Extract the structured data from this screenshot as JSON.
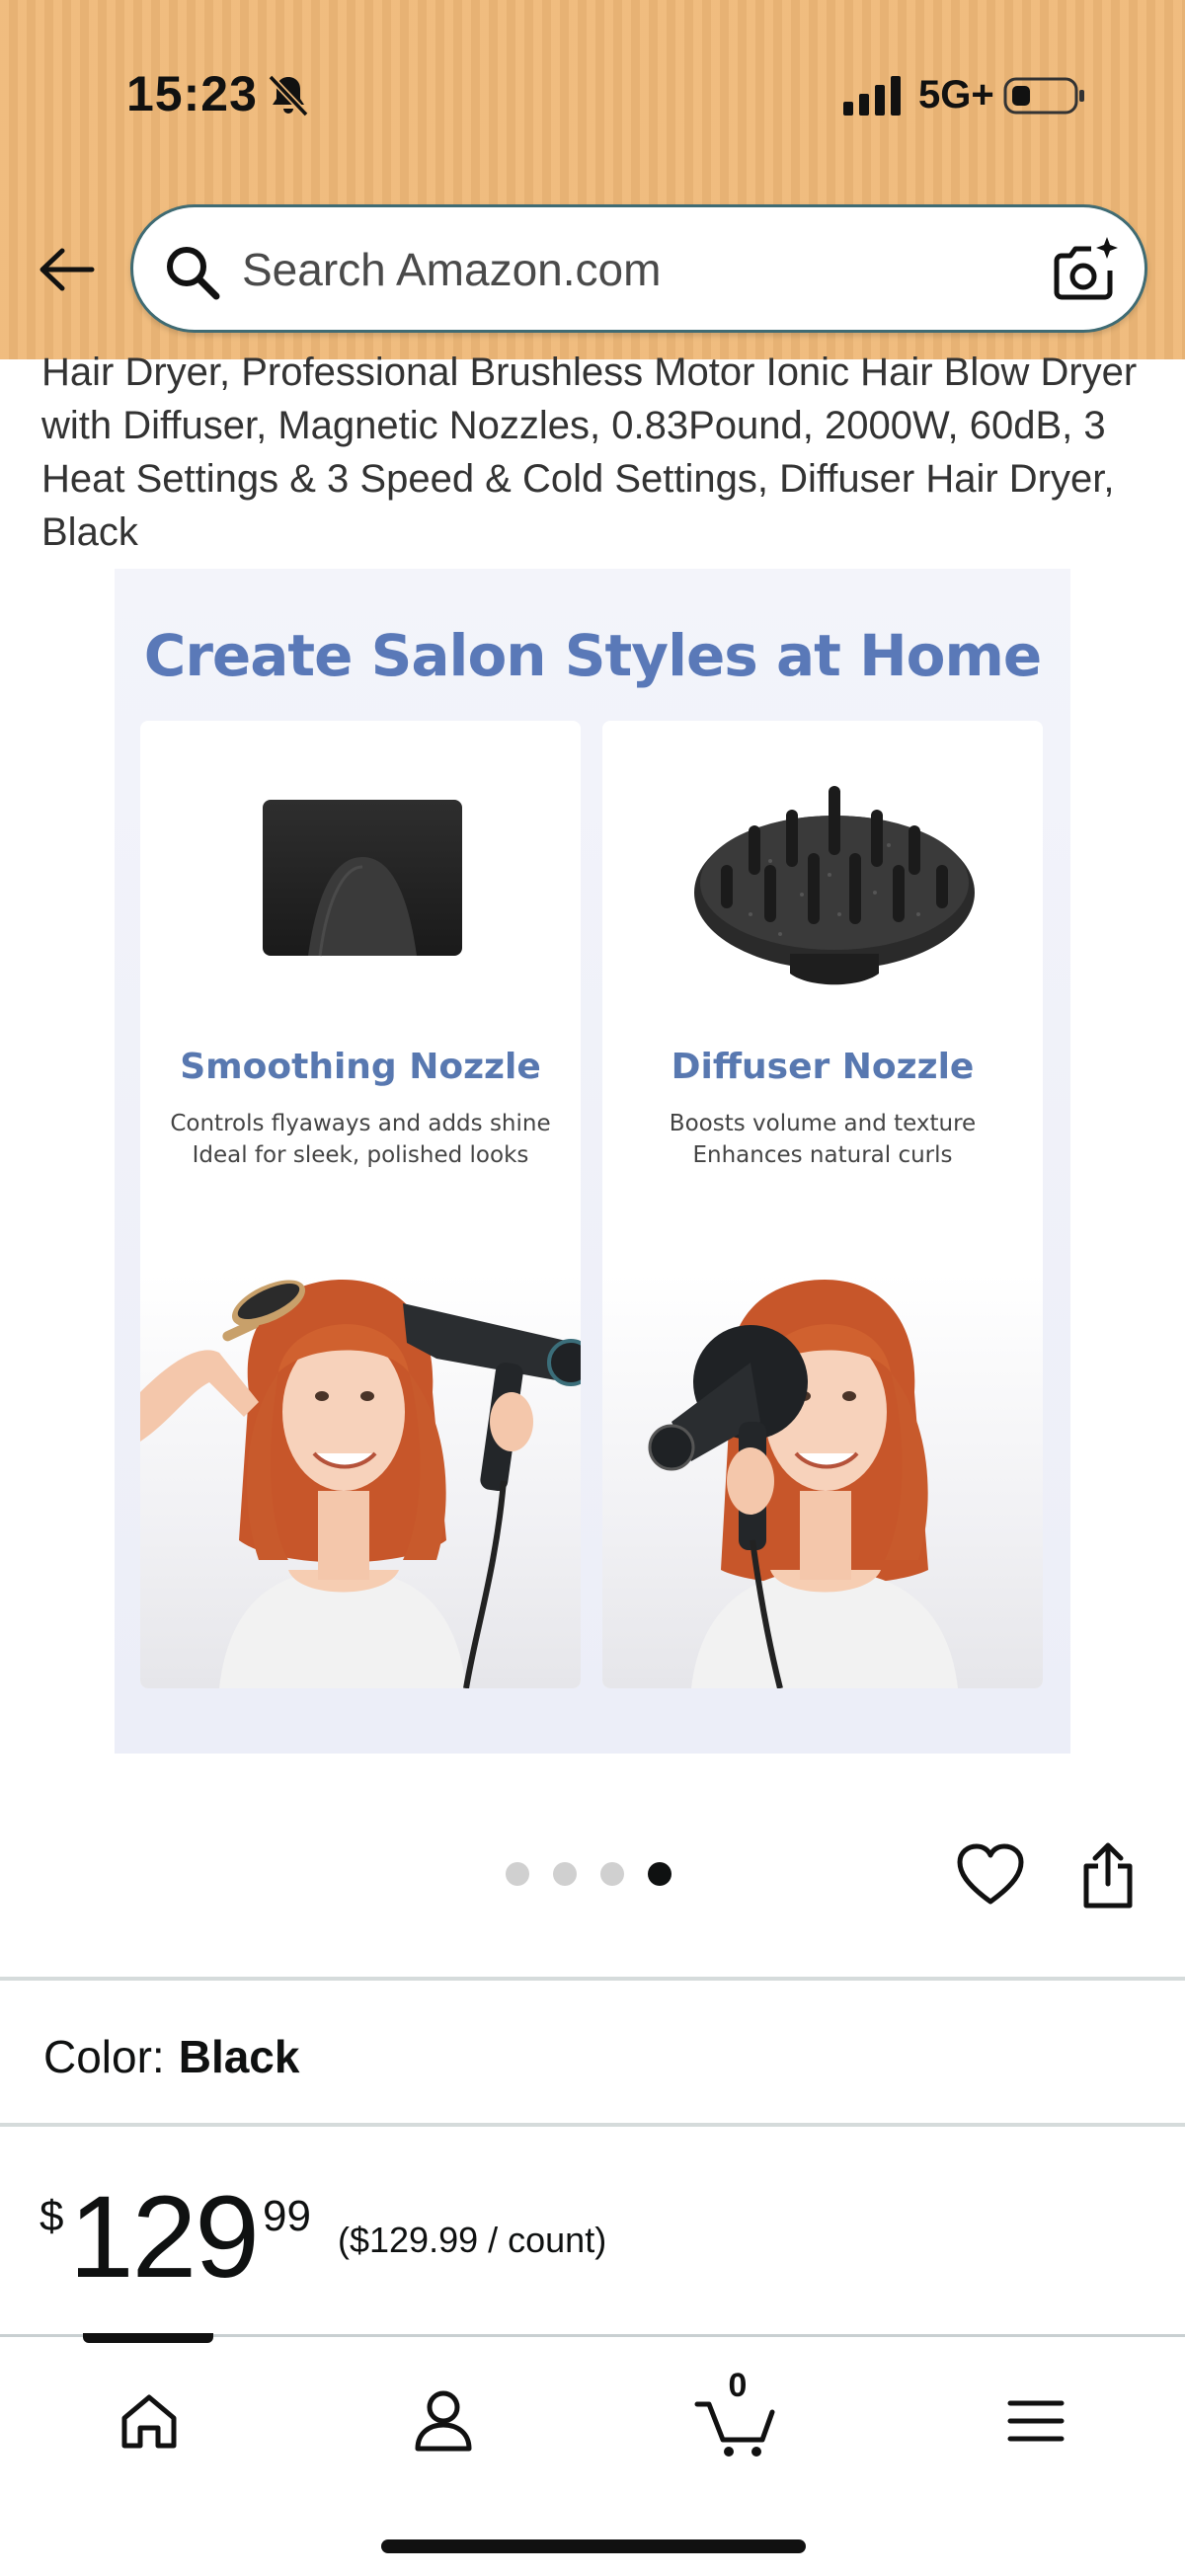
{
  "status_bar": {
    "time": "15:23",
    "network": "5G+",
    "icons": [
      "bell-slash-icon",
      "signal-icon",
      "battery-icon"
    ]
  },
  "header": {
    "back_icon": "arrow-left-icon",
    "search_placeholder": "Search Amazon.com",
    "search_icon": "search-icon",
    "camera_icon": "camera-search-icon",
    "background_color": "#efb978"
  },
  "product": {
    "title": "Hair Dryer, Professional Brushless Motor Ionic Hair Blow Dryer with Diffuser, Magnetic Nozzles, 0.83Pound, 2000W, 60dB, 3 Heat Settings & 3 Speed & Cold Settings, Diffuser Hair Dryer, Black",
    "image": {
      "heading": "Create Salon Styles at Home",
      "cards": [
        {
          "title": "Smoothing Nozzle",
          "line1": "Controls flyaways and adds shine",
          "line2": "Ideal for sleek, polished looks"
        },
        {
          "title": "Diffuser Nozzle",
          "line1": "Boosts volume and texture",
          "line2": "Enhances natural curls"
        }
      ]
    },
    "carousel": {
      "total": 4,
      "active_index": 3
    },
    "actions": {
      "favorite_icon": "heart-icon",
      "share_icon": "share-icon"
    },
    "color": {
      "label": "Color:",
      "value": "Black"
    },
    "price": {
      "symbol": "$",
      "whole": "129",
      "fraction": "99",
      "unit": "($129.99 / count)"
    }
  },
  "bottom_nav": {
    "items": [
      "home-icon",
      "account-icon",
      "cart-icon",
      "menu-icon"
    ],
    "cart_count": "0"
  },
  "colors": {
    "accent_heading": "#5a79b8",
    "text": "#0f1111"
  }
}
